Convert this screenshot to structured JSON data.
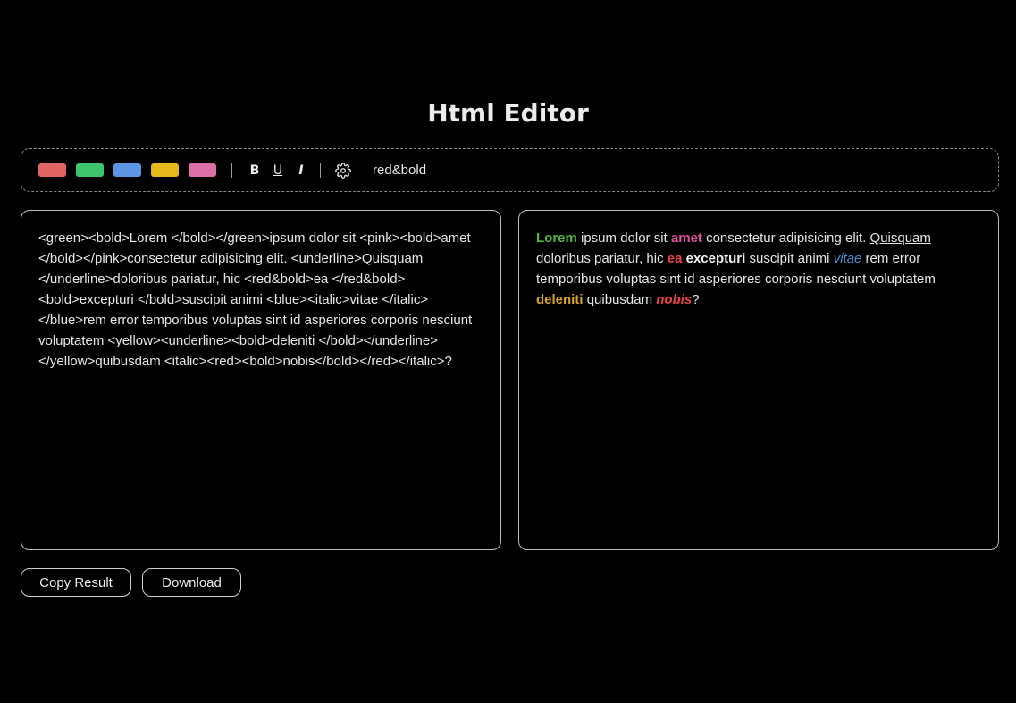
{
  "app": {
    "title": "Html Editor"
  },
  "toolbar": {
    "colors": [
      {
        "name": "red",
        "hex": "#e06666"
      },
      {
        "name": "green",
        "hex": "#3fc46e"
      },
      {
        "name": "blue",
        "hex": "#5b95e4"
      },
      {
        "name": "yellow",
        "hex": "#e7b81c"
      },
      {
        "name": "pink",
        "hex": "#dd6fa8"
      }
    ],
    "format_buttons": {
      "bold": "B",
      "underline": "U",
      "italic": "I"
    },
    "settings_icon": "gear-icon",
    "custom_tag": "red&bold"
  },
  "editor": {
    "source": "<green><bold>Lorem </bold></green>ipsum dolor sit <pink><bold>amet </bold></pink>consectetur adipisicing elit. <underline>Quisquam </underline>doloribus pariatur, hic <red&bold>ea </red&bold><bold>excepturi </bold>suscipit animi <blue><italic>vitae </italic></blue>rem error temporibus voluptas sint id asperiores corporis nesciunt voluptatem <yellow><underline><bold>deleniti </bold></underline></yellow>quibusdam <italic><red><bold>nobis</bold></red></italic>?"
  },
  "preview": {
    "segments": [
      {
        "text": "Lorem",
        "style": "c-green"
      },
      {
        "text": " ipsum dolor sit ",
        "style": ""
      },
      {
        "text": "amet",
        "style": "c-pink"
      },
      {
        "text": " consectetur adipisicing elit. ",
        "style": ""
      },
      {
        "text": "Quisquam ",
        "style": "w-under"
      },
      {
        "text": "doloribus pariatur, hic ",
        "style": ""
      },
      {
        "text": "ea",
        "style": "c-red"
      },
      {
        "text": " ",
        "style": ""
      },
      {
        "text": "excepturi",
        "style": "w-bold"
      },
      {
        "text": " suscipit animi ",
        "style": ""
      },
      {
        "text": "vitae",
        "style": "c-blue"
      },
      {
        "text": " rem error temporibus voluptas sint id asperiores corporis nesciunt voluptatem ",
        "style": ""
      },
      {
        "text": "deleniti ",
        "style": "c-yellow"
      },
      {
        "text": "quibusdam ",
        "style": ""
      },
      {
        "text": "nobis",
        "style": "c-nobis"
      },
      {
        "text": "?",
        "style": ""
      }
    ]
  },
  "actions": {
    "copy_label": "Copy Result",
    "download_label": "Download"
  }
}
